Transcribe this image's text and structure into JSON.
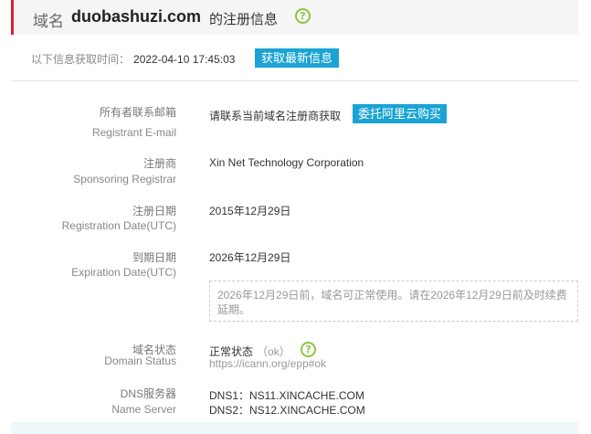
{
  "header": {
    "prefix": "域名",
    "domain": "duobashuzi.com",
    "suffix": "的注册信息",
    "help_glyph": "?"
  },
  "fetch": {
    "label": "以下信息获取时间：",
    "time": "2022-04-10 17:45:03",
    "refresh_button": "获取最新信息"
  },
  "fields": {
    "email": {
      "label_cn": "所有者联系邮箱",
      "label_en": "Registrant E-mail",
      "value": "请联系当前域名注册商获取",
      "button": "委托阿里云购买"
    },
    "registrar": {
      "label_cn": "注册商",
      "label_en": "Sponsoring Registrar",
      "value": "Xin Net Technology Corporation"
    },
    "registration": {
      "label_cn": "注册日期",
      "label_en": "Registration Date(UTC)",
      "value": "2015年12月29日"
    },
    "expiration": {
      "label_cn": "到期日期",
      "label_en": "Expiration Date(UTC)",
      "value": "2026年12月29日",
      "note": "2026年12月29日前，域名可正常使用。请在2026年12月29日前及时续费延期。"
    },
    "status": {
      "label_cn": "域名状态",
      "label_en": "Domain Status",
      "value": "正常状态",
      "code": "（ok）",
      "link": "https://icann.org/epp#ok",
      "help_glyph": "?"
    },
    "dns": {
      "label_cn": "DNS服务器",
      "label_en": "Name Server",
      "servers": [
        "DNS1：NS11.XINCACHE.COM",
        "DNS2：NS12.XINCACHE.COM"
      ]
    }
  },
  "colors": {
    "accent_red": "#d9232d",
    "button_blue": "#1aa3d4",
    "help_green": "#8cc63f"
  }
}
